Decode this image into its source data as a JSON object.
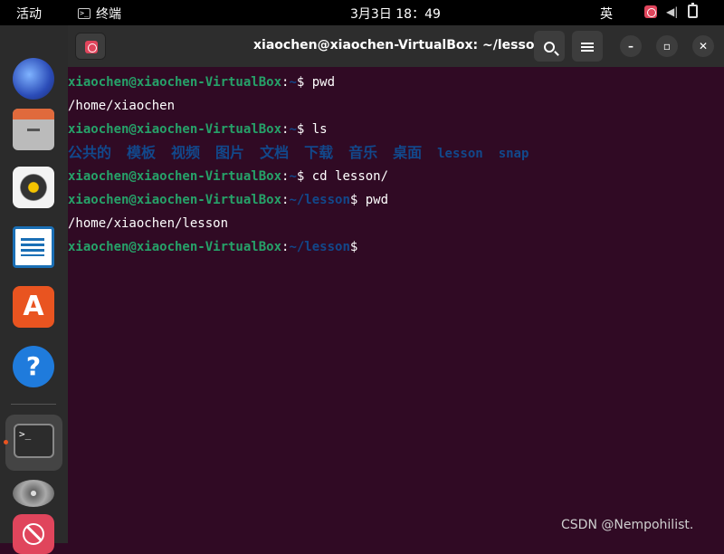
{
  "topbar": {
    "activities": "活动",
    "app_menu_label": "终端",
    "clock": "3月3日  18：49",
    "input_method": "英"
  },
  "dock": {
    "items": [
      {
        "name": "thunderbird"
      },
      {
        "name": "files"
      },
      {
        "name": "rhythmbox"
      },
      {
        "name": "libreoffice-writer"
      },
      {
        "name": "ubuntu-software",
        "glyph": "A"
      },
      {
        "name": "help",
        "glyph": "?"
      },
      {
        "name": "terminal",
        "glyph": ">_",
        "active": true
      },
      {
        "name": "disc"
      },
      {
        "name": "blocked-app"
      }
    ]
  },
  "window": {
    "title": "xiaochen@xiaochen-VirtualBox: ~/lesson"
  },
  "terminal": {
    "prompt_user": "xiaochen@xiaochen-VirtualBox",
    "lines": [
      {
        "type": "prompt",
        "path": "~",
        "cmd": "pwd"
      },
      {
        "type": "output",
        "text": "/home/xiaochen"
      },
      {
        "type": "prompt",
        "path": "~",
        "cmd": "ls"
      },
      {
        "type": "listing",
        "items": [
          "公共的",
          "模板",
          "视频",
          "图片",
          "文档",
          "下载",
          "音乐",
          "桌面",
          "lesson",
          "snap"
        ]
      },
      {
        "type": "prompt",
        "path": "~",
        "cmd": "cd lesson/"
      },
      {
        "type": "prompt",
        "path": "~/lesson",
        "cmd": "pwd"
      },
      {
        "type": "output",
        "text": "/home/xiaochen/lesson"
      },
      {
        "type": "prompt",
        "path": "~/lesson",
        "cmd": ""
      }
    ]
  },
  "watermark": "CSDN @Nempohilist.",
  "colors": {
    "terminal_bg": "#300a24",
    "prompt_user": "#26a269",
    "prompt_path": "#12488b",
    "accent": "#e95420"
  }
}
